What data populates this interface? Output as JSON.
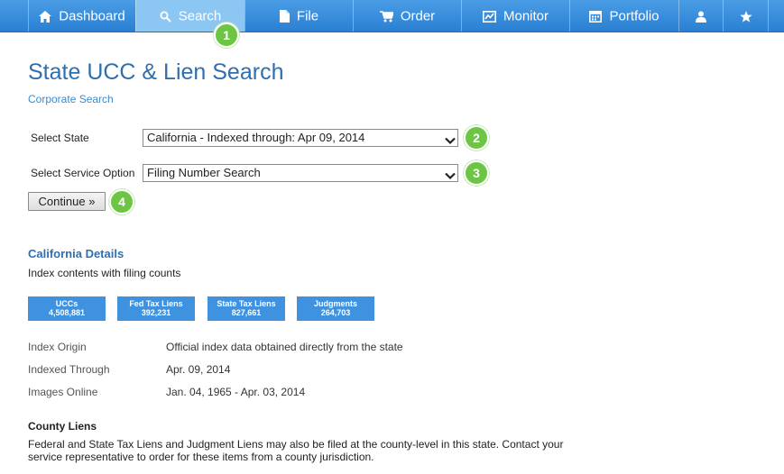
{
  "nav": {
    "items": [
      {
        "label": "Dashboard",
        "icon": "home-icon"
      },
      {
        "label": "Search",
        "icon": "search-icon"
      },
      {
        "label": "File",
        "icon": "file-icon"
      },
      {
        "label": "Order",
        "icon": "cart-icon"
      },
      {
        "label": "Monitor",
        "icon": "chart-icon"
      },
      {
        "label": "Portfolio",
        "icon": "calendar-icon"
      },
      {
        "label": "",
        "icon": "user-icon"
      },
      {
        "label": "",
        "icon": "star-icon"
      }
    ],
    "active": "Search"
  },
  "badges": [
    "1",
    "2",
    "3",
    "4"
  ],
  "page": {
    "title": "State UCC & Lien Search",
    "subtitle": "Corporate Search"
  },
  "form": {
    "state_label": "Select State",
    "state_value": "California - Indexed through: Apr 09, 2014",
    "service_label": "Select Service Option",
    "service_value": "Filing Number Search",
    "continue_label": "Continue »"
  },
  "details": {
    "title": "California Details",
    "description": "Index contents with filing counts",
    "stats": [
      {
        "label": "UCCs",
        "value": "4,508,881"
      },
      {
        "label": "Fed Tax Liens",
        "value": "392,231"
      },
      {
        "label": "State Tax Liens",
        "value": "827,661"
      },
      {
        "label": "Judgments",
        "value": "264,703"
      }
    ],
    "rows": [
      {
        "label": "Index Origin",
        "value": "Official index data obtained directly from the state"
      },
      {
        "label": "Indexed Through",
        "value": "Apr. 09, 2014"
      },
      {
        "label": "Images Online",
        "value": "Jan. 04, 1965 - Apr. 03, 2014"
      }
    ]
  },
  "county": {
    "title": "County Liens",
    "text": "Federal and State Tax Liens and Judgment Liens may also be filed at the county-level in this state. Contact your service representative to order for these items from a county jurisdiction."
  },
  "colors": {
    "nav": "#2f86d8",
    "nav_active": "#8cc6f2",
    "title": "#2f6fb0",
    "badge": "#6cc644",
    "stat_box": "#3f92e0"
  }
}
